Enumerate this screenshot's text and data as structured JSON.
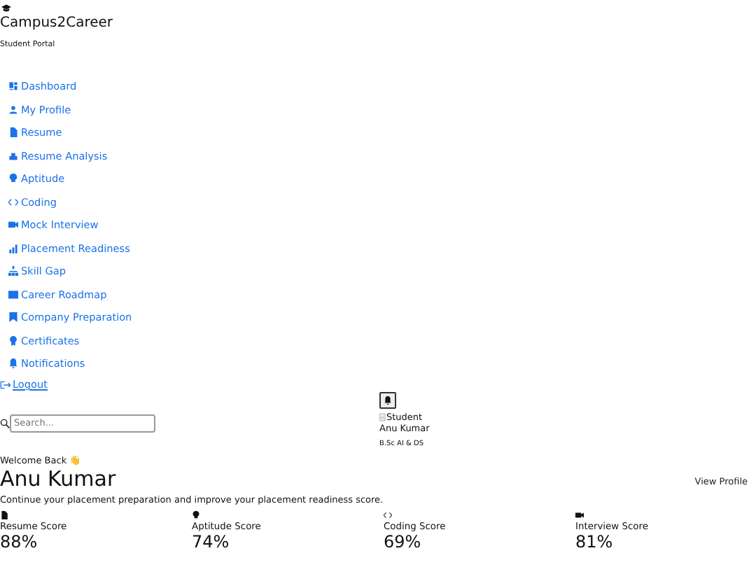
{
  "brand": {
    "title": "Campus2Career",
    "subtitle": "Student Portal"
  },
  "nav": [
    {
      "label": "Dashboard"
    },
    {
      "label": "My Profile"
    },
    {
      "label": "Resume"
    },
    {
      "label": "Resume Analysis"
    },
    {
      "label": "Aptitude"
    },
    {
      "label": "Coding"
    },
    {
      "label": "Mock Interview"
    },
    {
      "label": "Placement Readiness"
    },
    {
      "label": "Skill Gap"
    },
    {
      "label": "Career Roadmap"
    },
    {
      "label": "Company Preparation"
    },
    {
      "label": "Certificates"
    },
    {
      "label": "Notifications"
    }
  ],
  "logout": "Logout",
  "search": {
    "placeholder": "Search..."
  },
  "user": {
    "image_alt": "Student",
    "name": "Anu Kumar",
    "course": "B.Sc AI & DS"
  },
  "welcome": {
    "greeting": "Welcome Back 👋",
    "name": "Anu Kumar",
    "view_profile": "View Profile",
    "description": "Continue your placement preparation and improve your placement readiness score."
  },
  "scores": [
    {
      "label": "Resume Score",
      "value": "88%"
    },
    {
      "label": "Aptitude Score",
      "value": "74%"
    },
    {
      "label": "Coding Score",
      "value": "69%"
    },
    {
      "label": "Interview Score",
      "value": "81%"
    }
  ]
}
